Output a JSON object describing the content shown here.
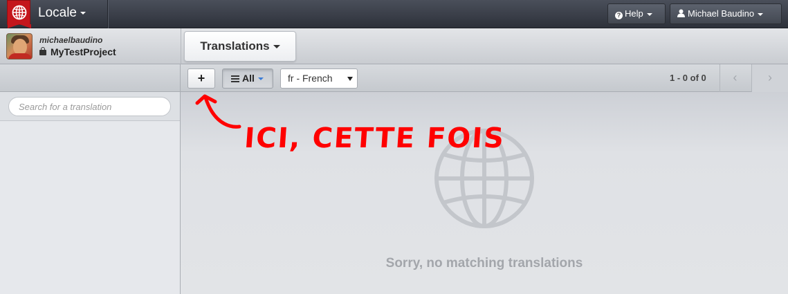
{
  "app": {
    "brand": "Locale",
    "logo_icon": "globe-logo-icon",
    "brand_color": "#c4161c"
  },
  "topbar": {
    "help_label": "Help",
    "user_label": "Michael Baudino"
  },
  "project": {
    "username": "michaelbaudino",
    "name": "MyTestProject",
    "section_label": "Translations"
  },
  "toolbar": {
    "add_label": "+",
    "filter_label": "All",
    "language": "fr - French",
    "pagination": "1 - 0 of 0",
    "prev_label": "‹",
    "next_label": "›"
  },
  "sidebar": {
    "search_placeholder": "Search for a translation"
  },
  "main": {
    "empty_message": "Sorry, no matching translations",
    "annotation_text": "ICI, CETTE FOIS",
    "annotation_color": "#ff0000"
  }
}
